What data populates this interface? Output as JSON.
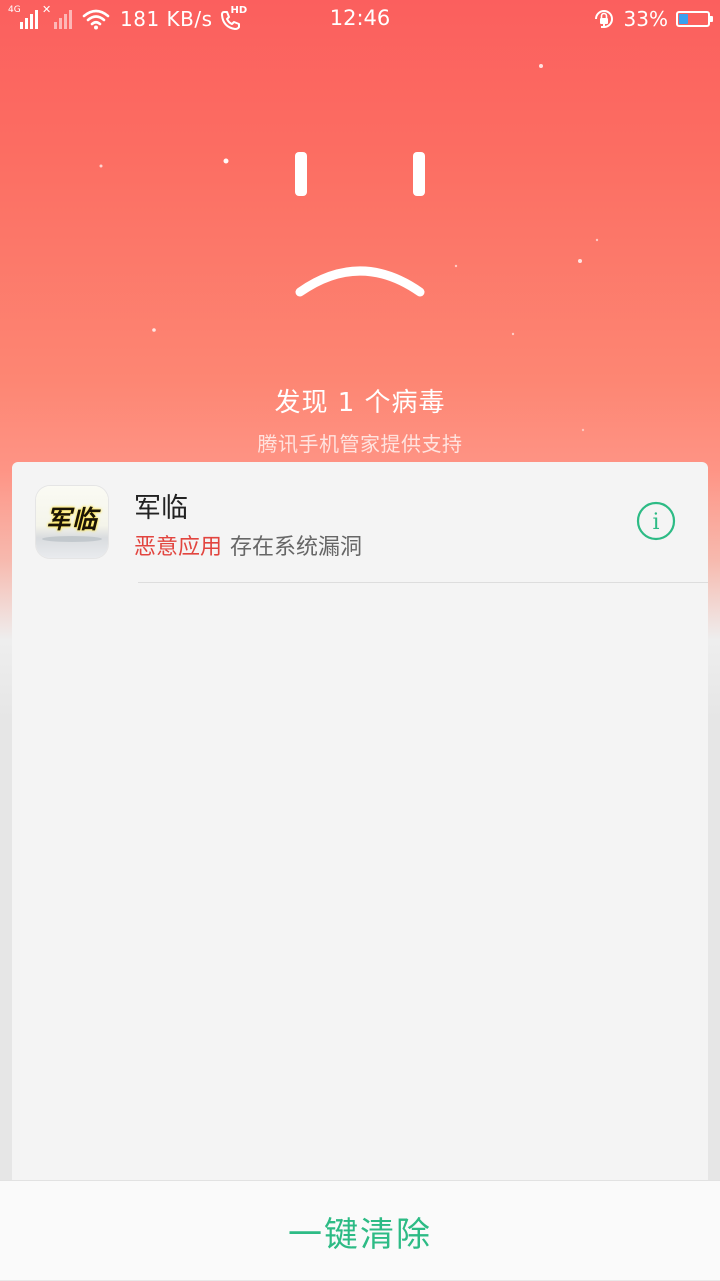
{
  "status_bar": {
    "network_type": "4G",
    "network_speed": "181 KB/s",
    "call_badge": "HD",
    "time": "12:46",
    "battery_percent": "33%",
    "battery_level": 0.33,
    "battery_color": "#3aa0f0"
  },
  "scan_result": {
    "title": "发现 1 个病毒",
    "subtitle": "腾讯手机管家提供支持"
  },
  "threats": [
    {
      "app_name": "军临",
      "icon_text": "军临",
      "risk_label": "恶意应用",
      "description": "存在系统漏洞",
      "info_icon": "info-icon"
    }
  ],
  "actions": {
    "clean_label": "一键清除"
  },
  "colors": {
    "header_gradient_top": "#fb5f5e",
    "risk_red": "#e2453f",
    "accent_green": "#2dbb85"
  }
}
